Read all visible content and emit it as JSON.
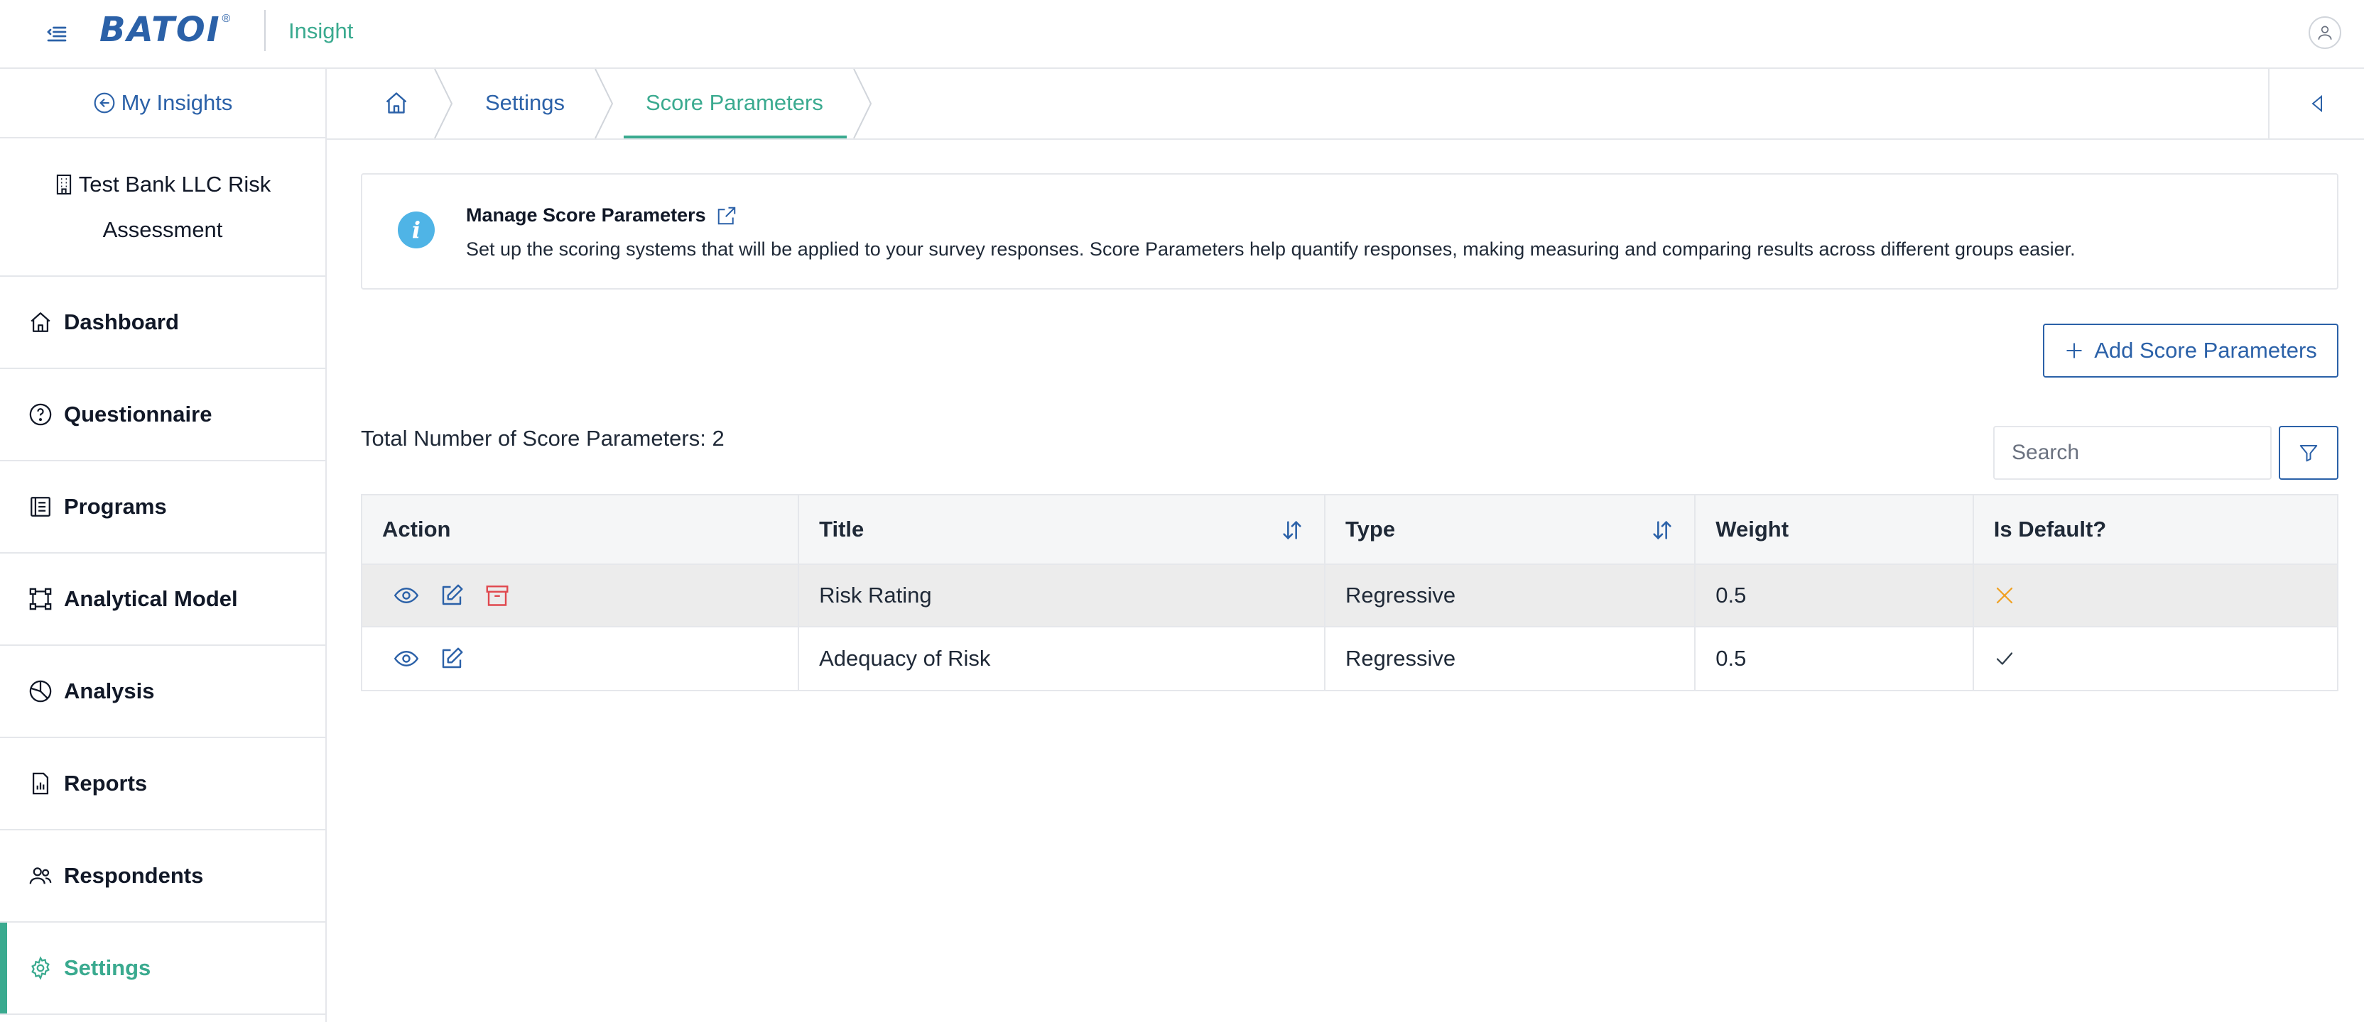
{
  "header": {
    "logo_text": "BATOI",
    "logo_reg": "®",
    "app_name": "Insight"
  },
  "sidebar": {
    "back_label": "My Insights",
    "org_line1": "Test Bank LLC Risk",
    "org_line2": "Assessment",
    "items": [
      {
        "label": "Dashboard",
        "icon": "home-icon"
      },
      {
        "label": "Questionnaire",
        "icon": "question-circle-icon"
      },
      {
        "label": "Programs",
        "icon": "list-icon"
      },
      {
        "label": "Analytical Model",
        "icon": "model-icon"
      },
      {
        "label": "Analysis",
        "icon": "pie-chart-icon"
      },
      {
        "label": "Reports",
        "icon": "report-icon"
      },
      {
        "label": "Respondents",
        "icon": "users-icon"
      },
      {
        "label": "Settings",
        "icon": "gear-icon",
        "active": true
      }
    ]
  },
  "breadcrumb": {
    "home_icon": "home-icon",
    "items": [
      "Settings",
      "Score Parameters"
    ]
  },
  "info": {
    "title": "Manage Score Parameters",
    "description": "Set up the scoring systems that will be applied to your survey responses. Score Parameters help quantify responses, making measuring and comparing results across different groups easier."
  },
  "actions": {
    "add_label": "Add Score Parameters"
  },
  "summary": {
    "total_label": "Total Number of Score Parameters: 2"
  },
  "search": {
    "placeholder": "Search",
    "value": ""
  },
  "table": {
    "headers": {
      "action": "Action",
      "title": "Title",
      "type": "Type",
      "weight": "Weight",
      "is_default": "Is Default?"
    },
    "rows": [
      {
        "title": "Risk Rating",
        "type": "Regressive",
        "weight": "0.5",
        "is_default": false,
        "actions": [
          "view",
          "edit",
          "archive"
        ]
      },
      {
        "title": "Adequacy of Risk",
        "type": "Regressive",
        "weight": "0.5",
        "is_default": true,
        "actions": [
          "view",
          "edit"
        ]
      }
    ]
  },
  "colors": {
    "brand_blue": "#2b61a8",
    "accent_green": "#3aaa8f",
    "danger_red": "#e0484e",
    "warning_orange": "#f0a020",
    "info_blue": "#4fb4e6"
  }
}
